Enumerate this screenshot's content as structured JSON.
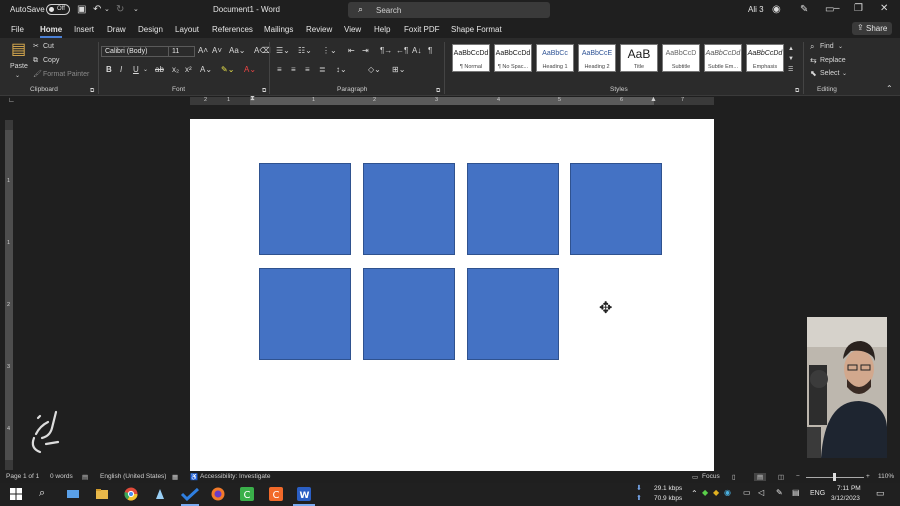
{
  "titlebar": {
    "autosave_label": "AutoSave",
    "autosave_state": "Off",
    "document_title": "Document1 - Word",
    "search_placeholder": "Search",
    "user_name": "Ali 3"
  },
  "menu": {
    "tabs": [
      "File",
      "Home",
      "Insert",
      "Draw",
      "Design",
      "Layout",
      "References",
      "Mailings",
      "Review",
      "View",
      "Help",
      "Foxit PDF",
      "Shape Format"
    ],
    "active_tab": "Home",
    "share_label": "Share"
  },
  "ribbon": {
    "clipboard": {
      "paste": "Paste",
      "cut": "Cut",
      "copy": "Copy",
      "format_painter": "Format Painter",
      "group_label": "Clipboard"
    },
    "font": {
      "font_name": "Calibri (Body)",
      "font_size": "11",
      "group_label": "Font"
    },
    "paragraph": {
      "group_label": "Paragraph"
    },
    "styles": {
      "group_label": "Styles",
      "items": [
        {
          "preview": "AaBbCcDd",
          "name": "¶ Normal"
        },
        {
          "preview": "AaBbCcDd",
          "name": "¶ No Spac..."
        },
        {
          "preview": "AaBbCc",
          "name": "Heading 1"
        },
        {
          "preview": "AaBbCcE",
          "name": "Heading 2"
        },
        {
          "preview": "AaB",
          "name": "Title"
        },
        {
          "preview": "AaBbCcD",
          "name": "Subtitle"
        },
        {
          "preview": "AaBbCcDd",
          "name": "Subtle Em..."
        },
        {
          "preview": "AaBbCcDd",
          "name": "Emphasis"
        }
      ]
    },
    "editing": {
      "find": "Find",
      "replace": "Replace",
      "select": "Select",
      "group_label": "Editing"
    }
  },
  "ruler": {
    "h_numbers": [
      "2",
      "1",
      "1",
      "2",
      "3",
      "4",
      "5",
      "6",
      "7"
    ],
    "v_numbers": [
      "1",
      "1",
      "2",
      "3",
      "4"
    ]
  },
  "document": {
    "shape_color": "#4472c4",
    "shape_count": 7
  },
  "statusbar": {
    "page": "Page 1 of 1",
    "words": "0 words",
    "language": "English (United States)",
    "accessibility": "Accessibility: Investigate",
    "focus": "Focus",
    "zoom": "110%"
  },
  "taskbar": {
    "net_up": "29.1 kbps",
    "net_down": "70.9 kbps",
    "lang": "ENG",
    "time": "7:11 PM",
    "date": "3/12/2023"
  },
  "webcam": {
    "caption": "مهدی"
  }
}
